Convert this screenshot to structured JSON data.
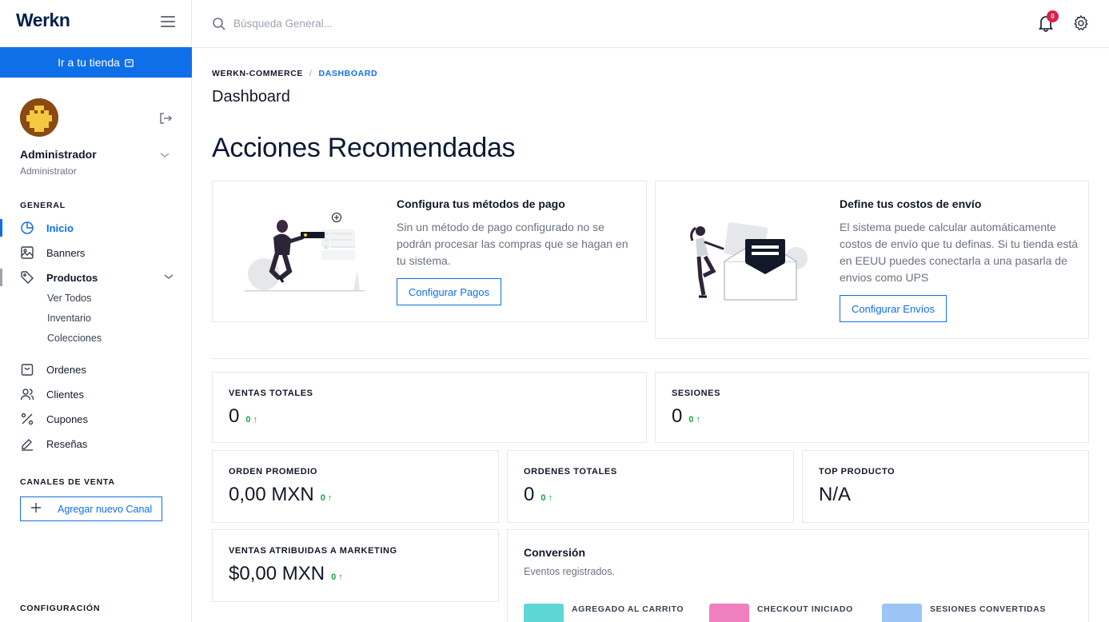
{
  "app": {
    "brand": "Werkn"
  },
  "sidebar": {
    "store_button": "Ir a tu tienda",
    "user": {
      "name": "Administrador",
      "role": "Administrator"
    },
    "general_title": "GENERAL",
    "items": [
      {
        "label": "Inicio",
        "icon": "pie-chart-icon",
        "active": true
      },
      {
        "label": "Banners",
        "icon": "image-icon"
      },
      {
        "label": "Productos",
        "icon": "tag-icon",
        "expanded": true
      },
      {
        "label": "Ordenes",
        "icon": "shopping-bag-icon"
      },
      {
        "label": "Clientes",
        "icon": "users-icon"
      },
      {
        "label": "Cupones",
        "icon": "percent-icon"
      },
      {
        "label": "Reseñas",
        "icon": "pencil-icon"
      }
    ],
    "product_subitems": [
      "Ver Todos",
      "Inventario",
      "Colecciones"
    ],
    "channels_title": "CANALES DE VENTA",
    "add_channel": "Agregar nuevo Canal",
    "config_title": "CONFIGURACIÓN"
  },
  "topbar": {
    "search_placeholder": "Búsqueda General...",
    "notification_count": "0"
  },
  "breadcrumb": {
    "root": "WERKN-COMMERCE",
    "separator": "/",
    "current": "DASHBOARD"
  },
  "page": {
    "title": "Dashboard",
    "section_title": "Acciones Recomendadas"
  },
  "actions": {
    "payment": {
      "title": "Configura tus métodos de pago",
      "body": "Sin un método de pago configurado no se podrán procesar las compras que se hagan en tu sistema.",
      "button": "Configurar Pagos"
    },
    "shipping": {
      "title": "Define tus costos de envío",
      "body": "El sistema puede calcular automáticamente costos de envío que tu definas. Si tu tienda está en EEUU puedes conectarla a una pasarla de envios como UPS",
      "button": "Configurar Envíos"
    }
  },
  "stats": {
    "ventas_totales": {
      "label": "VENTAS TOTALES",
      "value": "0",
      "delta": "0 ↑"
    },
    "sesiones": {
      "label": "SESIONES",
      "value": "0",
      "delta": "0 ↑"
    },
    "orden_promedio": {
      "label": "ORDEN PROMEDIO",
      "value": "0,00 MXN",
      "delta": "0 ↑"
    },
    "ordenes_totales": {
      "label": "ORDENES TOTALES",
      "value": "0",
      "delta": "0 ↑"
    },
    "top_producto": {
      "label": "TOP PRODUCTO",
      "value": "N/A"
    },
    "ventas_marketing": {
      "label": "VENTAS ATRIBUIDAS A MARKETING",
      "value": "$0,00 MXN",
      "delta": "0 ↑"
    }
  },
  "conversion": {
    "title": "Conversión",
    "subtitle": "Eventos registrados.",
    "legend": [
      {
        "label": "AGREGADO AL CARRITO",
        "color": "#5fd6d6"
      },
      {
        "label": "CHECKOUT INICIADO",
        "color": "#f07fc0"
      },
      {
        "label": "SESIONES CONVERTIDAS",
        "color": "#9cc4f5"
      }
    ]
  },
  "colors": {
    "primary": "#0f6fe8",
    "positive": "#16a34a",
    "badge": "#e11d48",
    "brand": "#0b1f4b"
  }
}
